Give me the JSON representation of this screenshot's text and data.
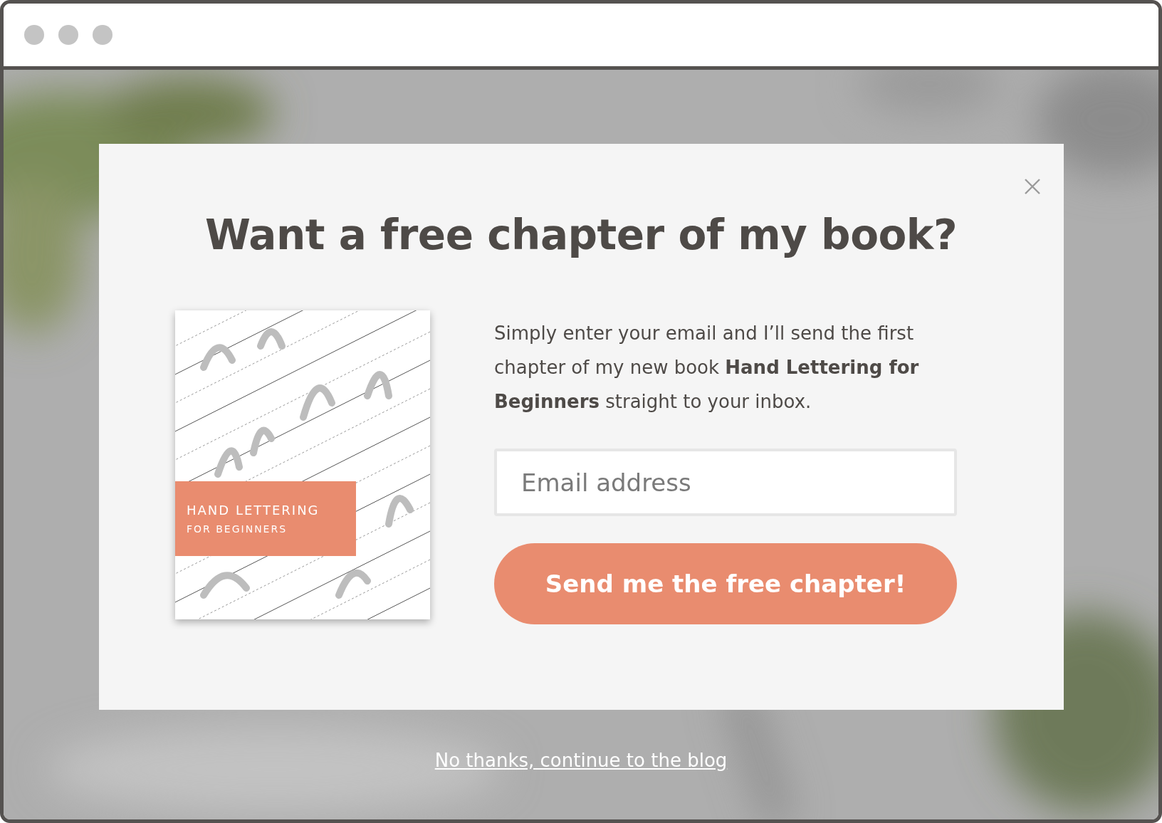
{
  "popup": {
    "title": "Want a free chapter of my book?",
    "cover": {
      "title": "HAND LETTERING",
      "subtitle": "FOR BEGINNERS"
    },
    "description": "Simply enter your email and I’ll send the first chapter of my new book **Hand Lettering for Beginners** straight to your inbox.",
    "email": {
      "placeholder": "Email address"
    },
    "submit": "Send me the free chapter!"
  },
  "dismiss_link": "No thanks, continue to the blog"
}
